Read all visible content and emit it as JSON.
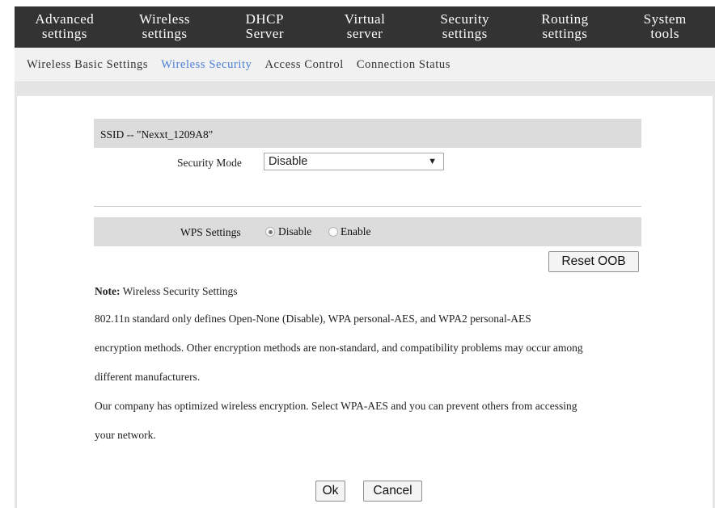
{
  "topnav": {
    "items": [
      {
        "line1": "Advanced",
        "line2": "settings"
      },
      {
        "line1": "Wireless",
        "line2": "settings"
      },
      {
        "line1": "DHCP",
        "line2": "Server"
      },
      {
        "line1": "Virtual",
        "line2": "server"
      },
      {
        "line1": "Security",
        "line2": "settings"
      },
      {
        "line1": "Routing",
        "line2": "settings"
      },
      {
        "line1": "System",
        "line2": "tools"
      }
    ],
    "active_index": 1
  },
  "subnav": {
    "items": [
      "Wireless Basic Settings",
      "Wireless Security",
      "Access Control",
      "Connection Status"
    ],
    "active_index": 1
  },
  "ssid": {
    "text": "SSID -- \"Nexxt_1209A8\""
  },
  "security_mode": {
    "label": "Security Mode",
    "value": "Disable"
  },
  "wps": {
    "label": "WPS Settings",
    "options": [
      "Disable",
      "Enable"
    ],
    "selected": "Disable",
    "reset_label": "Reset OOB"
  },
  "note": {
    "title": "Note:",
    "title_rest": " Wireless Security Settings",
    "lines": [
      "802.11n standard only defines Open-None (Disable), WPA personal-AES, and WPA2 personal-AES",
      "encryption methods. Other encryption methods are non-standard, and compatibility problems may occur among",
      "different manufacturers.",
      "Our company has optimized wireless encryption. Select WPA-AES and you can prevent others from accessing",
      "your network."
    ]
  },
  "actions": {
    "ok_label": "Ok",
    "cancel_label": "Cancel"
  },
  "colors": {
    "topnav_bg": "#333333",
    "active_link": "#4a7fd8",
    "bar_bg": "#dcdcdc"
  }
}
